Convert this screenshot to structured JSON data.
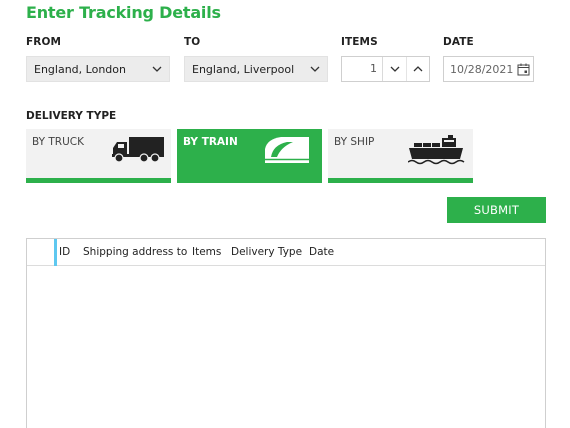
{
  "page": {
    "title": "Enter Tracking Details"
  },
  "form": {
    "from": {
      "label": "FROM",
      "value": "England, London"
    },
    "to": {
      "label": "TO",
      "value": "England, Liverpool"
    },
    "items": {
      "label": "ITEMS",
      "value": "1"
    },
    "date": {
      "label": "DATE",
      "value": "10/28/2021"
    }
  },
  "delivery": {
    "label": "DELIVERY TYPE",
    "options": [
      {
        "label": "BY TRUCK",
        "icon": "truck-icon",
        "selected": false
      },
      {
        "label": "BY TRAIN",
        "icon": "train-icon",
        "selected": true
      },
      {
        "label": "BY SHIP",
        "icon": "ship-icon",
        "selected": false
      }
    ]
  },
  "submit_label": "SUBMIT",
  "grid": {
    "columns": [
      "ID",
      "Shipping address to",
      "Items",
      "Delivery Type",
      "Date"
    ],
    "rows": []
  },
  "colors": {
    "accent": "#2db04b",
    "selection_indicator": "#5ec8f0",
    "field_bg": "#ececec",
    "tile_bg": "#f2f2f2"
  }
}
